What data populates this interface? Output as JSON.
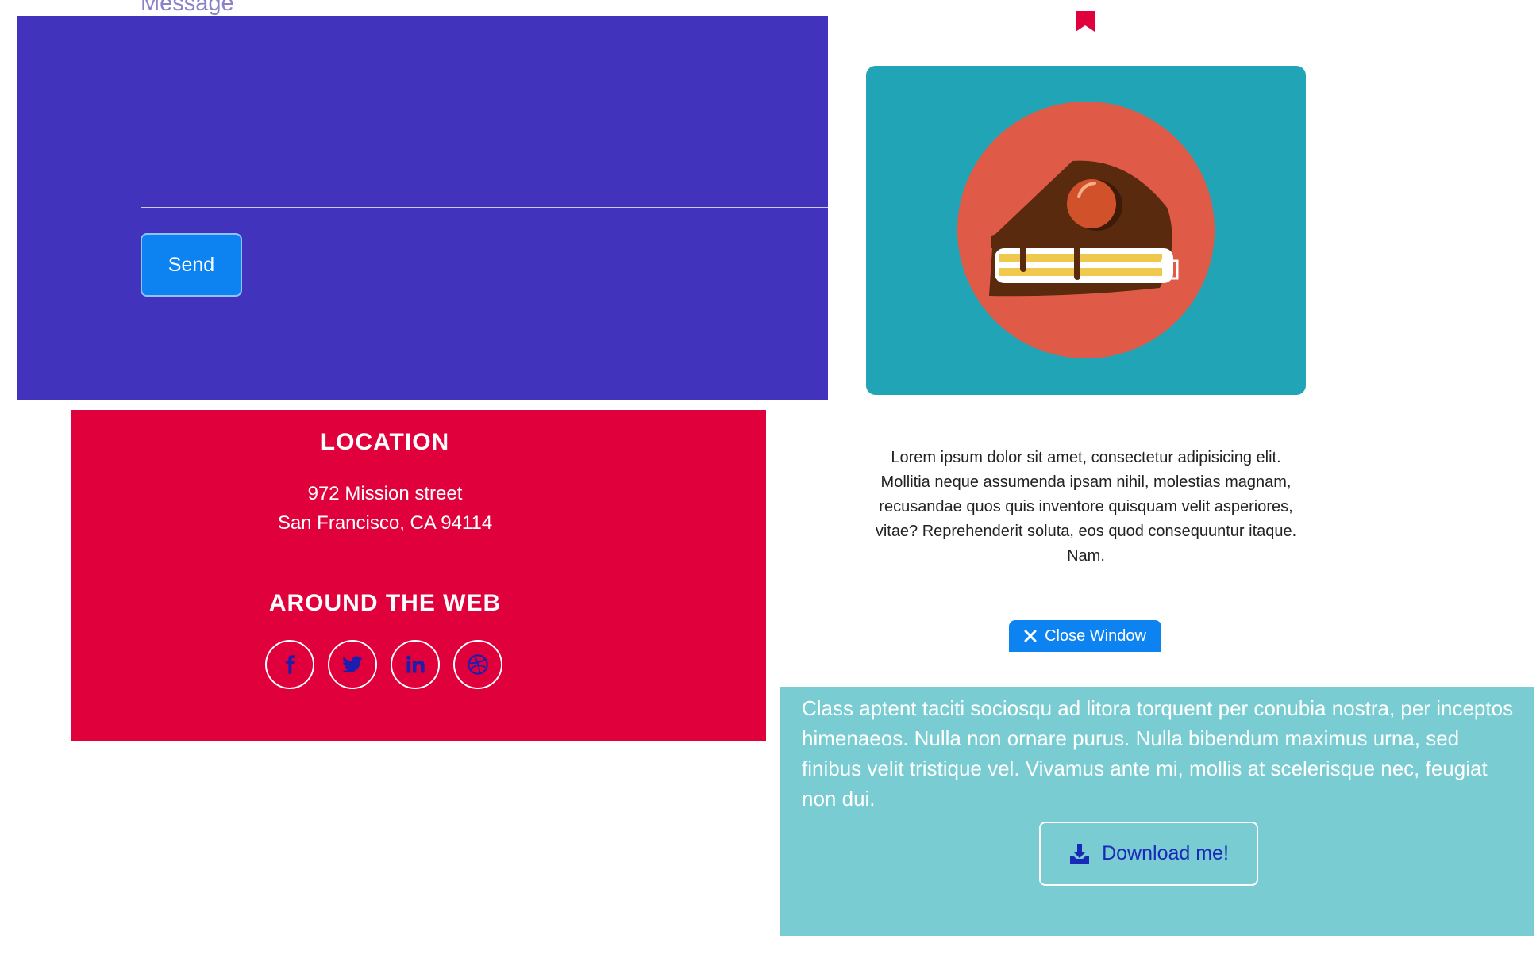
{
  "contact": {
    "message_placeholder": "Message",
    "send_label": "Send"
  },
  "footer": {
    "location_heading": "LOCATION",
    "address_line1": "972 Mission street",
    "address_line2": "San Francisco, CA 94114",
    "web_heading": "AROUND THE WEB",
    "social_icons": [
      "facebook-icon",
      "twitter-icon",
      "linkedin-icon",
      "dribbble-icon"
    ]
  },
  "modal": {
    "icon": "bookmark-icon",
    "image_subject": "cake-slice-illustration",
    "text": "Lorem ipsum dolor sit amet, consectetur adipisicing elit. Mollitia neque assumenda ipsam nihil, molestias magnam, recusandae quos quis inventore quisquam velit asperiores, vitae? Reprehenderit soluta, eos quod consequuntur itaque. Nam.",
    "close_label": "Close Window"
  },
  "download": {
    "text": "Class aptent taciti sociosqu ad litora torquent per conubia nostra, per inceptos himenaeos. Nulla non ornare purus. Nulla bibendum maximus urna, sed finibus velit tristique vel. Vivamus ante mi, mollis at scelerisque nec, feugiat non dui.",
    "button_label": "Download me!"
  },
  "colors": {
    "contact_bg": "#4133bb",
    "footer_bg": "#e0003c",
    "card_bg": "#20a4b6",
    "download_bg": "#79cdd2",
    "primary_button": "#0d83f2"
  }
}
